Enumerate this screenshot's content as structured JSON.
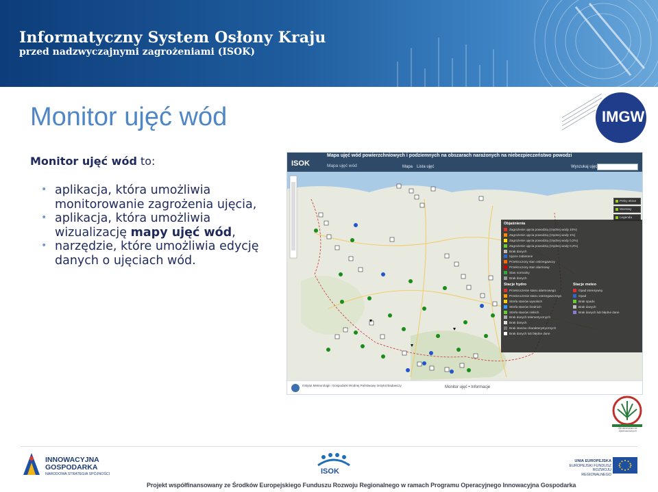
{
  "banner": {
    "title": "Informatyczny System Osłony Kraju",
    "subtitle": "przed nadzwyczajnymi zagrożeniami (ISOK)"
  },
  "slide": {
    "title": "Monitor ujęć wód",
    "intro_bold": "Monitor ujęć wód",
    "intro_rest": " to:",
    "bullets": [
      {
        "text": "aplikacja, która umożliwia monitorowanie zagrożenia ujęcia,"
      },
      {
        "pre": "aplikacja, która umożliwia wizualizację ",
        "bold": "mapy ujęć wód",
        "post": ","
      },
      {
        "text": "narzędzie, które umożliwia edycję danych o ujęciach wód."
      }
    ]
  },
  "logos": {
    "imgw": "IMGW",
    "seal_caption": "Ministerstwo ze Zjednoczonych",
    "innowacyjna_line1": "INNOWACYJNA",
    "innowacyjna_line2": "GOSPODARKA",
    "innowacyjna_tag": "NARODOWA STRATEGIA SPÓJNOŚCI",
    "isok": "ISOK",
    "ue_line1": "UNIA EUROPEJSKA",
    "ue_line2": "EUROPEJSKI FUNDUSZ",
    "ue_line3": "ROZWOJU REGIONALNEGO"
  },
  "screenshot": {
    "logo": "ISOK",
    "title": "Mapa ujęć wód powierzchniowych i podziemnych na obszarach narażonych na niebezpieczeństwo powodzi",
    "nav": "Mapa ujęć wód",
    "tabs": [
      "Mapa",
      "Lista ujęć"
    ],
    "search_label": "Wyszukaj ujęcie:",
    "side_buttons": [
      "Pełny ekran",
      "Warstwy",
      "Legenda"
    ],
    "legend_title": "Objaśnienia",
    "legend_rows": [
      {
        "label": "Zagrożenie ujęcia powodzią (rzędnej wody 10%)",
        "color": "#e03030"
      },
      {
        "label": "Zagrożenie ujęcia powodzią (rzędnej wody 1%)",
        "color": "#ff8800"
      },
      {
        "label": "Zagrożenie ujęcia powodzią (rzędnej wody 0,2%)",
        "color": "#ffdd00"
      },
      {
        "label": "Zagrożenie ujęcia powodzią (rzędnej wody 0,2%)",
        "color": "#66cc33"
      },
      {
        "label": "Brak danych",
        "color": "#bbbbbb"
      },
      {
        "label": "Ujęcie zabierane",
        "color": "#3366cc"
      },
      {
        "label": "Przekroczony stan ostrzegawczy",
        "color": "#ff6600"
      },
      {
        "label": "Przekroczony stan alarmowy",
        "color": "#cc0000"
      },
      {
        "label": "Stan normalny",
        "color": "#33aa33"
      },
      {
        "label": "Brak danych",
        "color": "#999999"
      }
    ],
    "legend_hydro_title": "Stacje hydro",
    "legend_hydro": [
      {
        "label": "Przekroczenie stanu alarmowego",
        "color": "#e03030"
      },
      {
        "label": "Przekroczenie stanu ostrzegawczego",
        "color": "#ff9900"
      },
      {
        "label": "Strefa stanów wysokich",
        "color": "#ffcc00"
      },
      {
        "label": "Strefa stanów średnich",
        "color": "#3399ff"
      },
      {
        "label": "Strefa stanów niskich",
        "color": "#66cc33"
      },
      {
        "label": "Brak danych telemetrycznych",
        "color": "#aaaaaa"
      },
      {
        "label": "Brak danych",
        "color": "#dddddd"
      },
      {
        "label": "Brak stanów charakterystycznych",
        "color": "#777777"
      },
      {
        "label": "Brak danych lub błędne dane",
        "color": "#ffffff"
      }
    ],
    "legend_meteo_title": "Stacje meteo",
    "legend_meteo": [
      {
        "label": "Opad intensywny",
        "color": "#e03030"
      },
      {
        "label": "Opad",
        "color": "#3366cc"
      },
      {
        "label": "Brak opadu",
        "color": "#66cc33"
      },
      {
        "label": "Brak danych",
        "color": "#bbbbbb"
      },
      {
        "label": "Brak danych lub błędne dane",
        "color": "#8a7fcf"
      }
    ],
    "footer_inst": "Instytut Meteorologii i Gospodarki Wodnej Państwowy Instytut Badawczy",
    "footer": "Monitor ujęć • Informacje"
  },
  "footnote": "Projekt współfinansowany ze Środków Europejskiego Funduszu Rozwoju Regionalnego w ramach Programu Operacyjnego Innowacyjna Gospodarka"
}
